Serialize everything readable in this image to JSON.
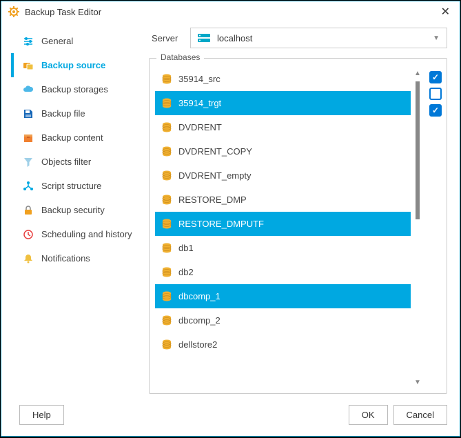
{
  "window": {
    "title": "Backup Task Editor"
  },
  "sidebar": {
    "items": [
      {
        "label": "General"
      },
      {
        "label": "Backup source"
      },
      {
        "label": "Backup storages"
      },
      {
        "label": "Backup file"
      },
      {
        "label": "Backup content"
      },
      {
        "label": "Objects filter"
      },
      {
        "label": "Script structure"
      },
      {
        "label": "Backup security"
      },
      {
        "label": "Scheduling and history"
      },
      {
        "label": "Notifications"
      }
    ]
  },
  "server": {
    "label": "Server",
    "value": "localhost"
  },
  "group": {
    "label": "Databases"
  },
  "databases": [
    {
      "name": "35914_src"
    },
    {
      "name": "35914_trgt"
    },
    {
      "name": "DVDRENT"
    },
    {
      "name": "DVDRENT_COPY"
    },
    {
      "name": "DVDRENT_empty"
    },
    {
      "name": "RESTORE_DMP"
    },
    {
      "name": "RESTORE_DMPUTF"
    },
    {
      "name": "db1"
    },
    {
      "name": "db2"
    },
    {
      "name": "dbcomp_1"
    },
    {
      "name": "dbcomp_2"
    },
    {
      "name": "dellstore2"
    }
  ],
  "footer": {
    "help": "Help",
    "ok": "OK",
    "cancel": "Cancel"
  }
}
